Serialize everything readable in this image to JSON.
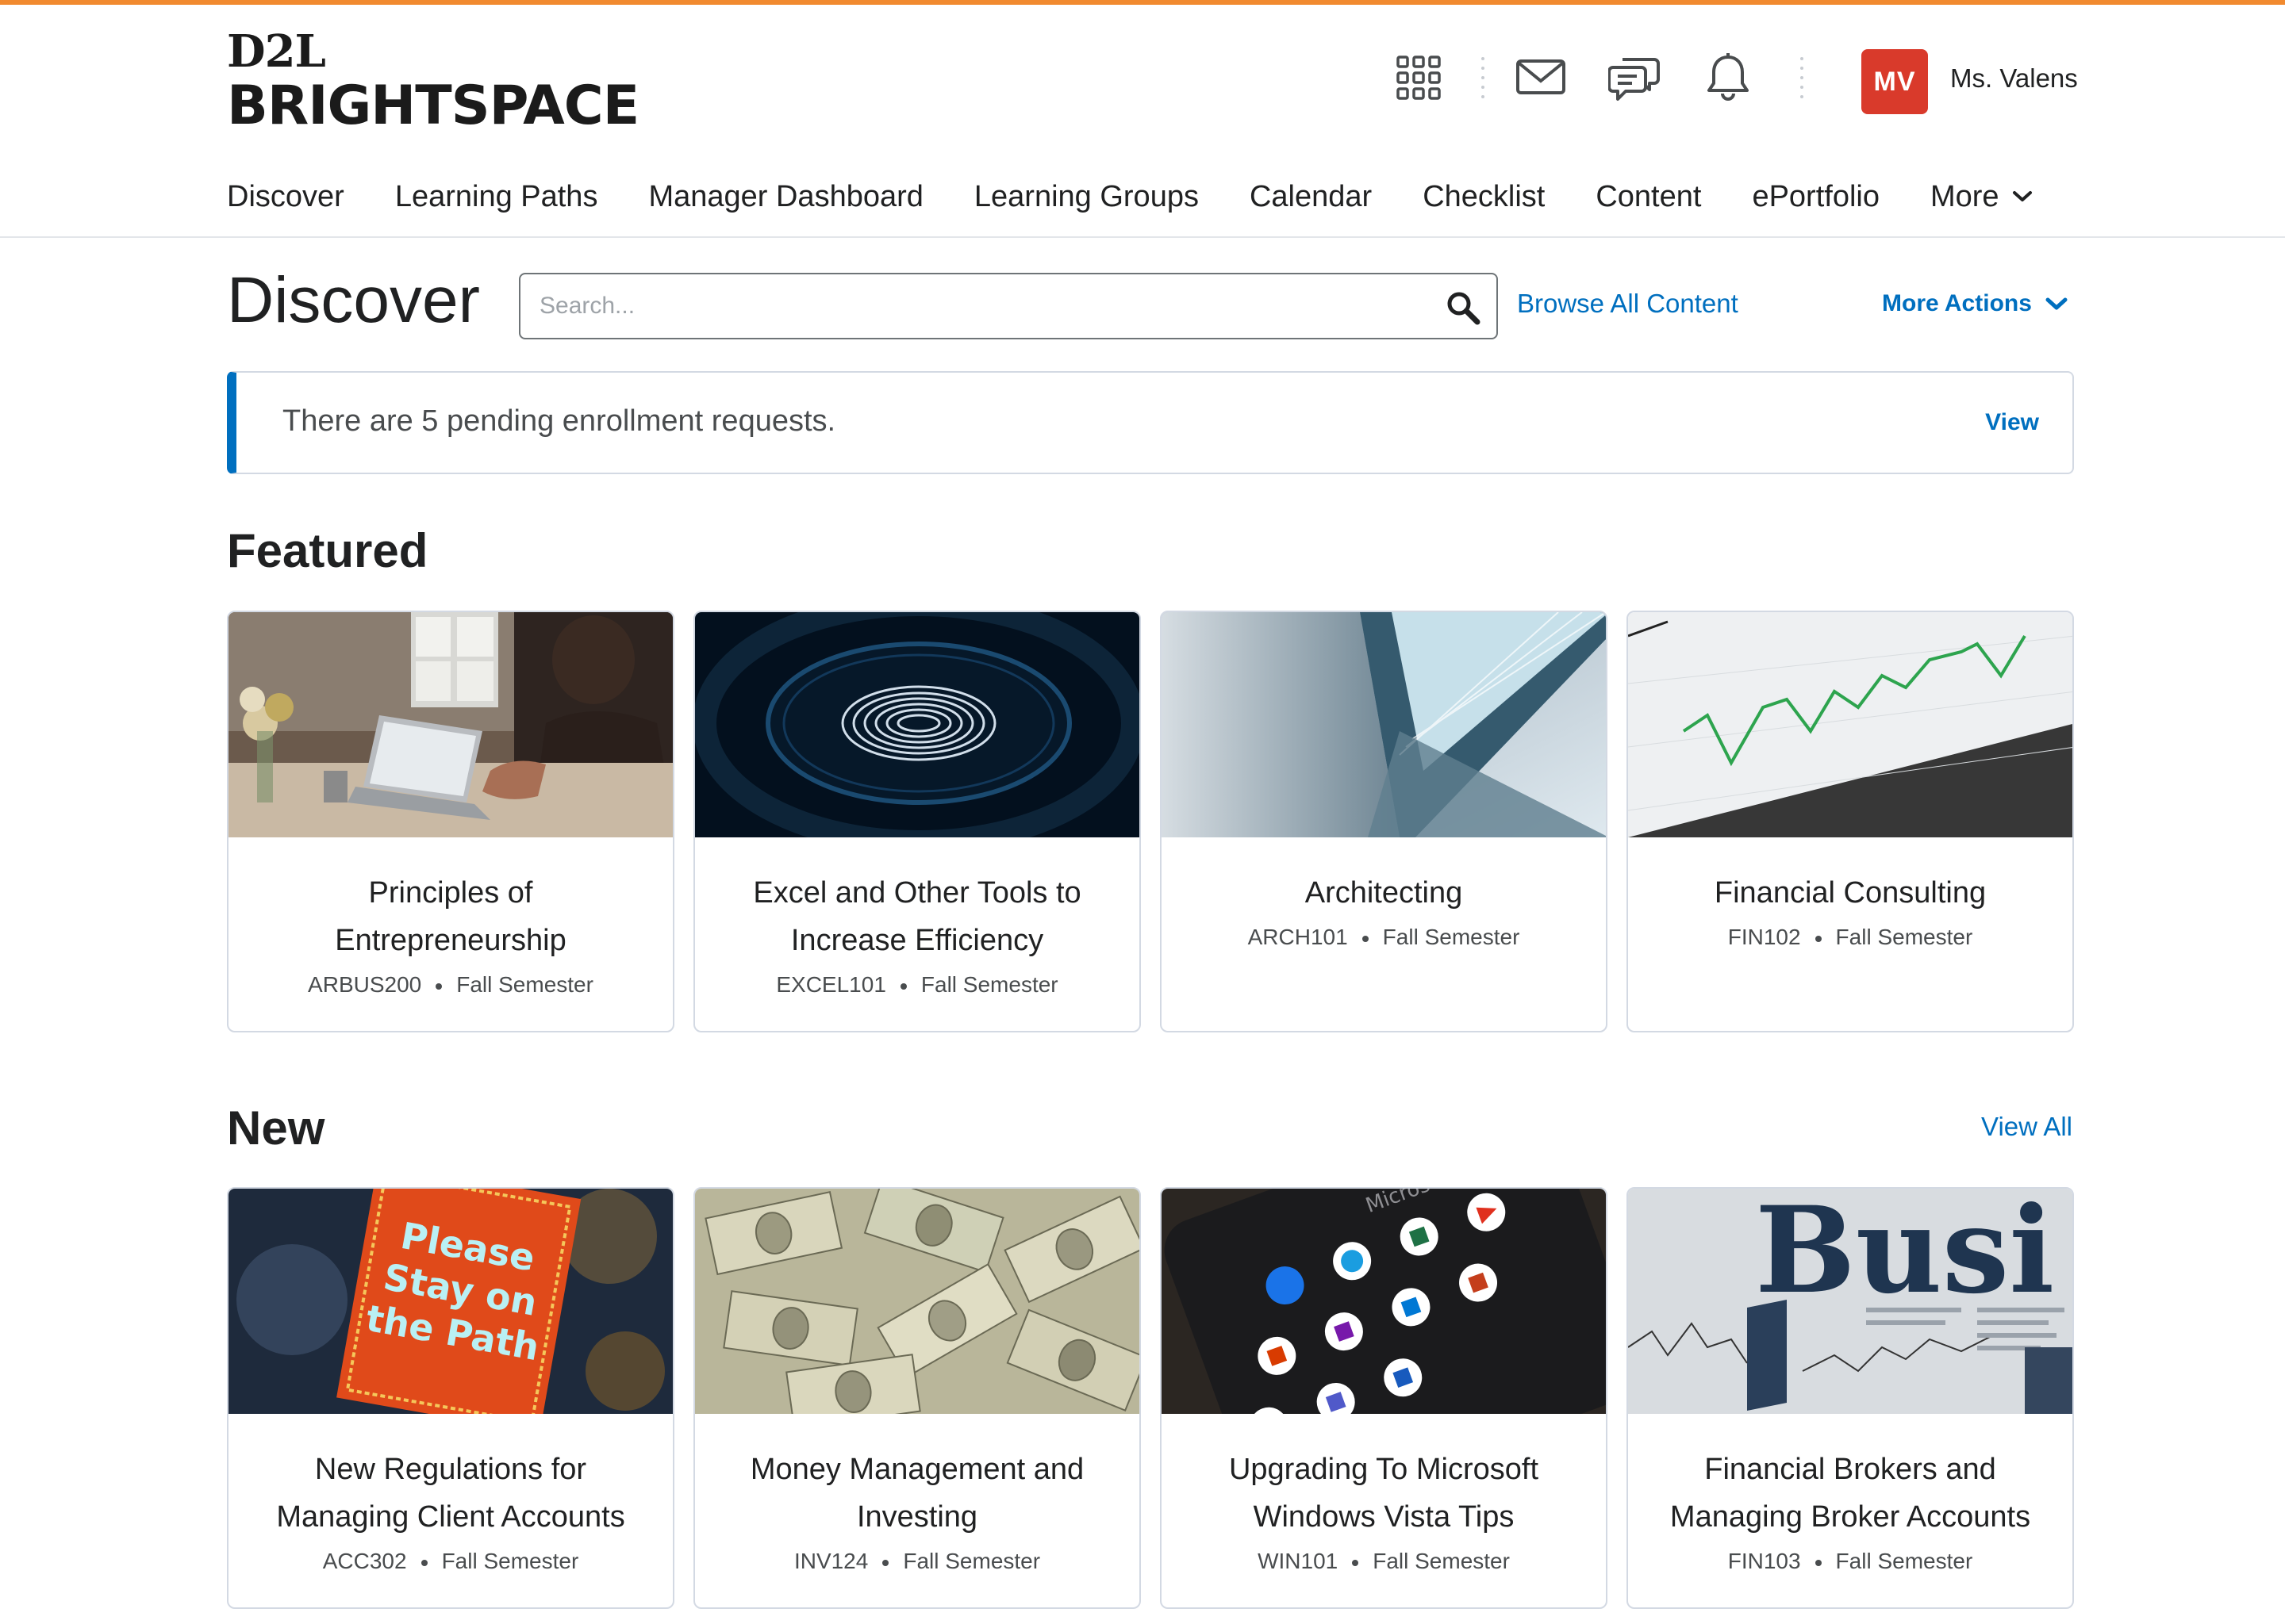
{
  "brand": {
    "line1": "D2L",
    "line2": "BRIGHTSPACE",
    "accent_color": "#f18a2f"
  },
  "header": {
    "icons": [
      "waffle-grid-icon",
      "mail-icon",
      "chat-icon",
      "bell-icon"
    ],
    "user": {
      "initials": "MV",
      "name": "Ms. Valens",
      "avatar_color": "#d93a2b"
    }
  },
  "nav": {
    "items": [
      "Discover",
      "Learning Paths",
      "Manager Dashboard",
      "Learning Groups",
      "Calendar",
      "Checklist",
      "Content",
      "ePortfolio"
    ],
    "more_label": "More"
  },
  "discover": {
    "title": "Discover",
    "search_placeholder": "Search...",
    "browse_label": "Browse All Content",
    "more_actions_label": "More Actions",
    "link_color": "#006fbf"
  },
  "alert": {
    "text": "There are 5 pending enrollment requests.",
    "action": "View"
  },
  "featured": {
    "title": "Featured",
    "cards": [
      {
        "title": "Principles of Entrepreneurship",
        "code": "ARBUS200",
        "term": "Fall Semester",
        "image": "workspace-laptop-photo"
      },
      {
        "title": "Excel and Other Tools to Increase Efficiency",
        "code": "EXCEL101",
        "term": "Fall Semester",
        "image": "fingerprint-photo"
      },
      {
        "title": "Architecting",
        "code": "ARCH101",
        "term": "Fall Semester",
        "image": "building-photo"
      },
      {
        "title": "Financial Consulting",
        "code": "FIN102",
        "term": "Fall Semester",
        "image": "stock-chart-photo"
      }
    ]
  },
  "new": {
    "title": "New",
    "view_all": "View All",
    "cards": [
      {
        "title": "New Regulations for Managing Client Accounts",
        "code": "ACC302",
        "term": "Fall Semester",
        "image": "stay-on-path-book-photo",
        "image_text": [
          "Please",
          "Stay on",
          "the Path"
        ]
      },
      {
        "title": "Money Management and Investing",
        "code": "INV124",
        "term": "Fall Semester",
        "image": "dollar-bills-photo"
      },
      {
        "title": "Upgrading To Microsoft Windows Vista Tips",
        "code": "WIN101",
        "term": "Fall Semester",
        "image": "microsoft-apps-phone-photo",
        "image_text": [
          "Microsoft"
        ]
      },
      {
        "title": "Financial Brokers and Managing Broker Accounts",
        "code": "FIN103",
        "term": "Fall Semester",
        "image": "business-newspaper-photo",
        "image_text": [
          "Busi"
        ]
      }
    ]
  }
}
